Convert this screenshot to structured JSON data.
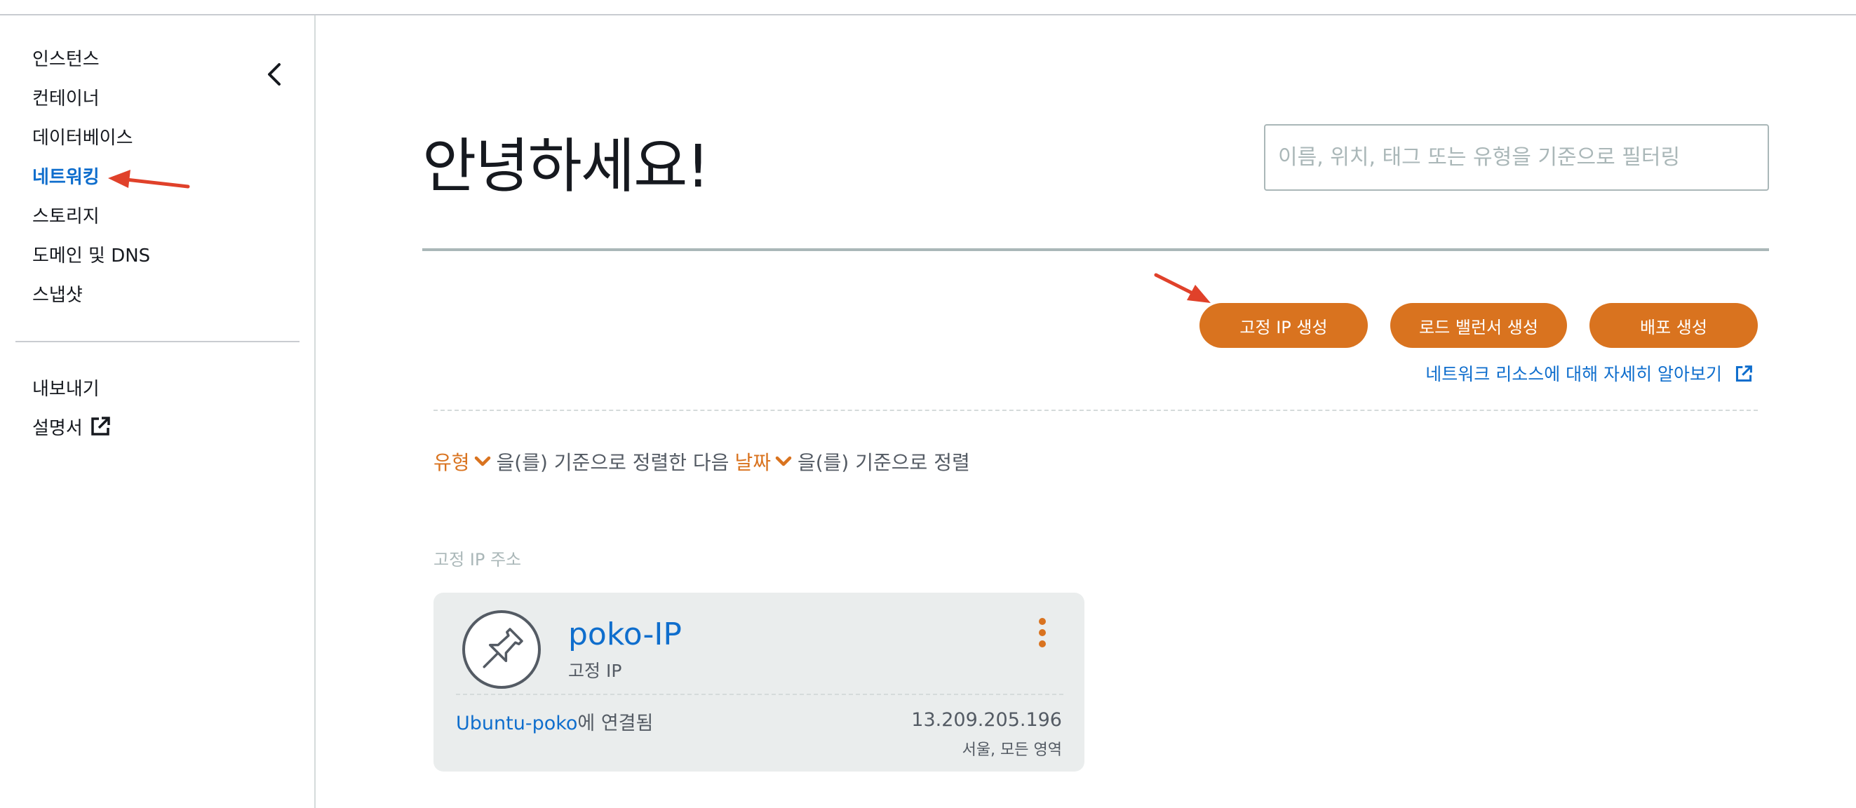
{
  "sidebar": {
    "items": [
      {
        "label": "인스턴스"
      },
      {
        "label": "컨테이너"
      },
      {
        "label": "데이터베이스"
      },
      {
        "label": "네트워킹"
      },
      {
        "label": "스토리지"
      },
      {
        "label": "도메인 및 DNS"
      },
      {
        "label": "스냅샷"
      }
    ],
    "secondary": [
      {
        "label": "내보내기"
      },
      {
        "label": "설명서"
      }
    ],
    "active_item": "네트워킹"
  },
  "main": {
    "greeting": "안녕하세요!",
    "search": {
      "placeholder": "이름, 위치, 태그 또는 유형을 기준으로 필터링",
      "value": ""
    },
    "actions": {
      "create_static_ip": "고정 IP 생성",
      "create_load_balancer": "로드 밸런서 생성",
      "create_distribution": "배포 생성"
    },
    "learn_more": "네트워크 리소스에 대해 자세히 알아보기",
    "sort": {
      "key1": "유형",
      "text1": "을(를) 기준으로 정렬한 다음",
      "key2": "날짜",
      "text2": "을(를) 기준으로 정렬"
    },
    "section_label": "고정 IP 주소",
    "card": {
      "name": "poko-IP",
      "type": "고정 IP",
      "attached_instance": "Ubuntu-poko",
      "attached_suffix": "에 연결됨",
      "ip": "13.209.205.196",
      "region": "서울, 모든 영역"
    }
  },
  "colors": {
    "accent": "#d9731f",
    "link": "#0f6ecd",
    "annotation_arrow": "#e0412a",
    "card_bg": "#eaeded"
  },
  "icons": [
    "chevron-left-icon",
    "external-link-icon",
    "chevron-down-icon",
    "pushpin-icon",
    "kebab-menu-icon"
  ]
}
